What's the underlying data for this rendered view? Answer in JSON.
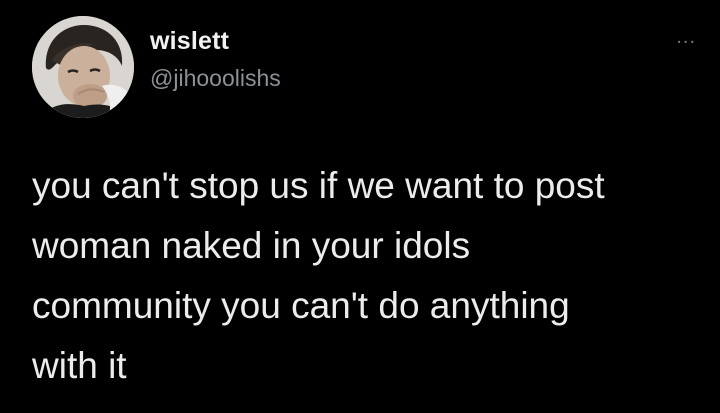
{
  "tweet": {
    "author": {
      "display_name": "wislett",
      "handle": "@jihooolishs",
      "avatar_icon": "profile-photo"
    },
    "more_menu": {
      "icon": "more-horizontal-icon",
      "label": "..."
    },
    "text_lines": [
      "you can't stop us if we want to post",
      "woman naked in your idols",
      "community you can't do anything",
      "with it"
    ]
  },
  "colors": {
    "background": "#000000",
    "text_primary": "#ececec",
    "text_secondary": "#8b9197"
  }
}
